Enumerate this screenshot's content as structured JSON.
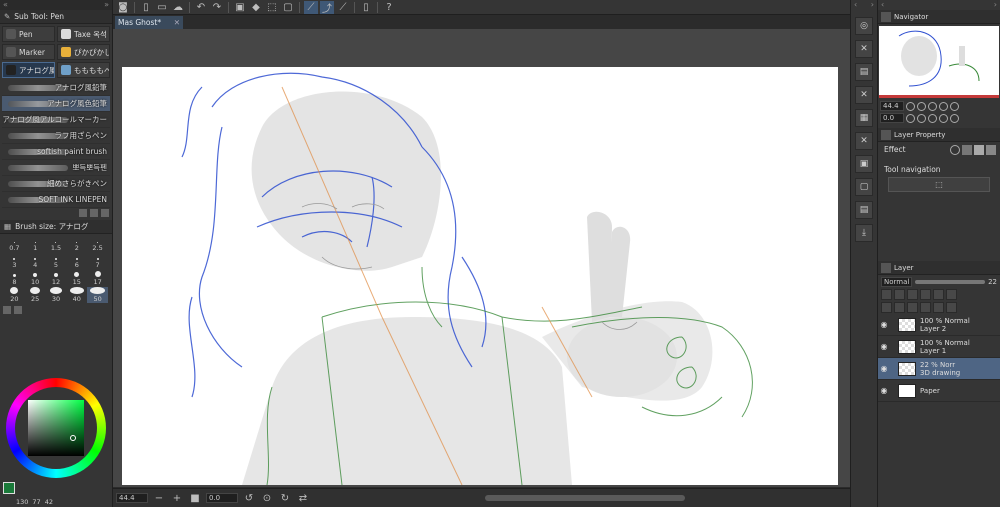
{
  "left_panel": {
    "top_left": "«",
    "top_right": "»",
    "subtool_title": "Sub Tool: Pen",
    "tools": [
      {
        "label": "Pen",
        "selected": false
      },
      {
        "label": "Taxe 옥석",
        "selected": false
      },
      {
        "label": "Marker",
        "selected": false
      },
      {
        "label": "ぴかぴかし",
        "selected": false
      },
      {
        "label": "アナログ風",
        "selected": true
      },
      {
        "label": "ももももペン",
        "selected": false
      }
    ],
    "brushes": [
      {
        "label": "アナログ風鉛筆",
        "selected": false
      },
      {
        "label": "アナログ風色鉛筆",
        "selected": true
      },
      {
        "label": "アナログ風アルコールマーカー",
        "selected": false
      },
      {
        "label": "ラフ用ざらペン",
        "selected": false
      },
      {
        "label": "softish paint brush",
        "selected": false
      },
      {
        "label": "뽀득뽀득펜",
        "selected": false
      },
      {
        "label": "細めさらがきペン",
        "selected": false
      },
      {
        "label": "SOFT INK LINEPEN",
        "selected": false
      }
    ],
    "brushsize_title": "Brush size: アナログ",
    "sizes": [
      {
        "v": "0.7",
        "d": 1
      },
      {
        "v": "1",
        "d": 1
      },
      {
        "v": "1.5",
        "d": 1
      },
      {
        "v": "2",
        "d": 1
      },
      {
        "v": "2.5",
        "d": 1
      },
      {
        "v": "3",
        "d": 2
      },
      {
        "v": "4",
        "d": 2
      },
      {
        "v": "5",
        "d": 2
      },
      {
        "v": "6",
        "d": 2
      },
      {
        "v": "7",
        "d": 2
      },
      {
        "v": "8",
        "d": 3
      },
      {
        "v": "10",
        "d": 4
      },
      {
        "v": "12",
        "d": 4
      },
      {
        "v": "15",
        "d": 5
      },
      {
        "v": "17",
        "d": 6
      },
      {
        "v": "20",
        "d": 8
      },
      {
        "v": "25",
        "d": 10
      },
      {
        "v": "30",
        "d": 12
      },
      {
        "v": "40",
        "d": 14
      },
      {
        "v": "50",
        "d": 15
      }
    ],
    "selected_size": "50",
    "color_values": {
      "h": "130",
      "s": "77",
      "v": "42"
    },
    "main_color": "#1a7a3a",
    "sub_color": "#ffffff"
  },
  "toolbar": {
    "icons": [
      "app-icon",
      "new-icon",
      "open-icon",
      "save-icon",
      "undo-icon",
      "redo-icon",
      "clear-icon",
      "fill-icon",
      "transform-icon",
      "selection-icon",
      "line-tool-icon",
      "curve-tool-icon",
      "ruler-icon",
      "phone-icon",
      "help-icon"
    ]
  },
  "document": {
    "tab_label": "Mas Ghost*",
    "close": "✕"
  },
  "status": {
    "zoom": "44.4",
    "angle": "0.0"
  },
  "navigator": {
    "title": "Navigator",
    "zoom": "44.4",
    "angle": "0.0"
  },
  "layer_property": {
    "title": "Layer Property",
    "effect_label": "Effect",
    "tool_navigation": "Tool navigation"
  },
  "layer_panel": {
    "title": "Layer",
    "blend_mode": "Normal",
    "opacity": "22",
    "layers": [
      {
        "line1": "100 % Normal",
        "line2": "Layer 2",
        "selected": false,
        "paper": false
      },
      {
        "line1": "100 % Normal",
        "line2": "Layer 1",
        "selected": false,
        "paper": false
      },
      {
        "line1": "22 % Norr",
        "line2": "3D drawing",
        "selected": true,
        "paper": false
      },
      {
        "line1": "Paper",
        "line2": "",
        "selected": false,
        "paper": true
      }
    ]
  }
}
